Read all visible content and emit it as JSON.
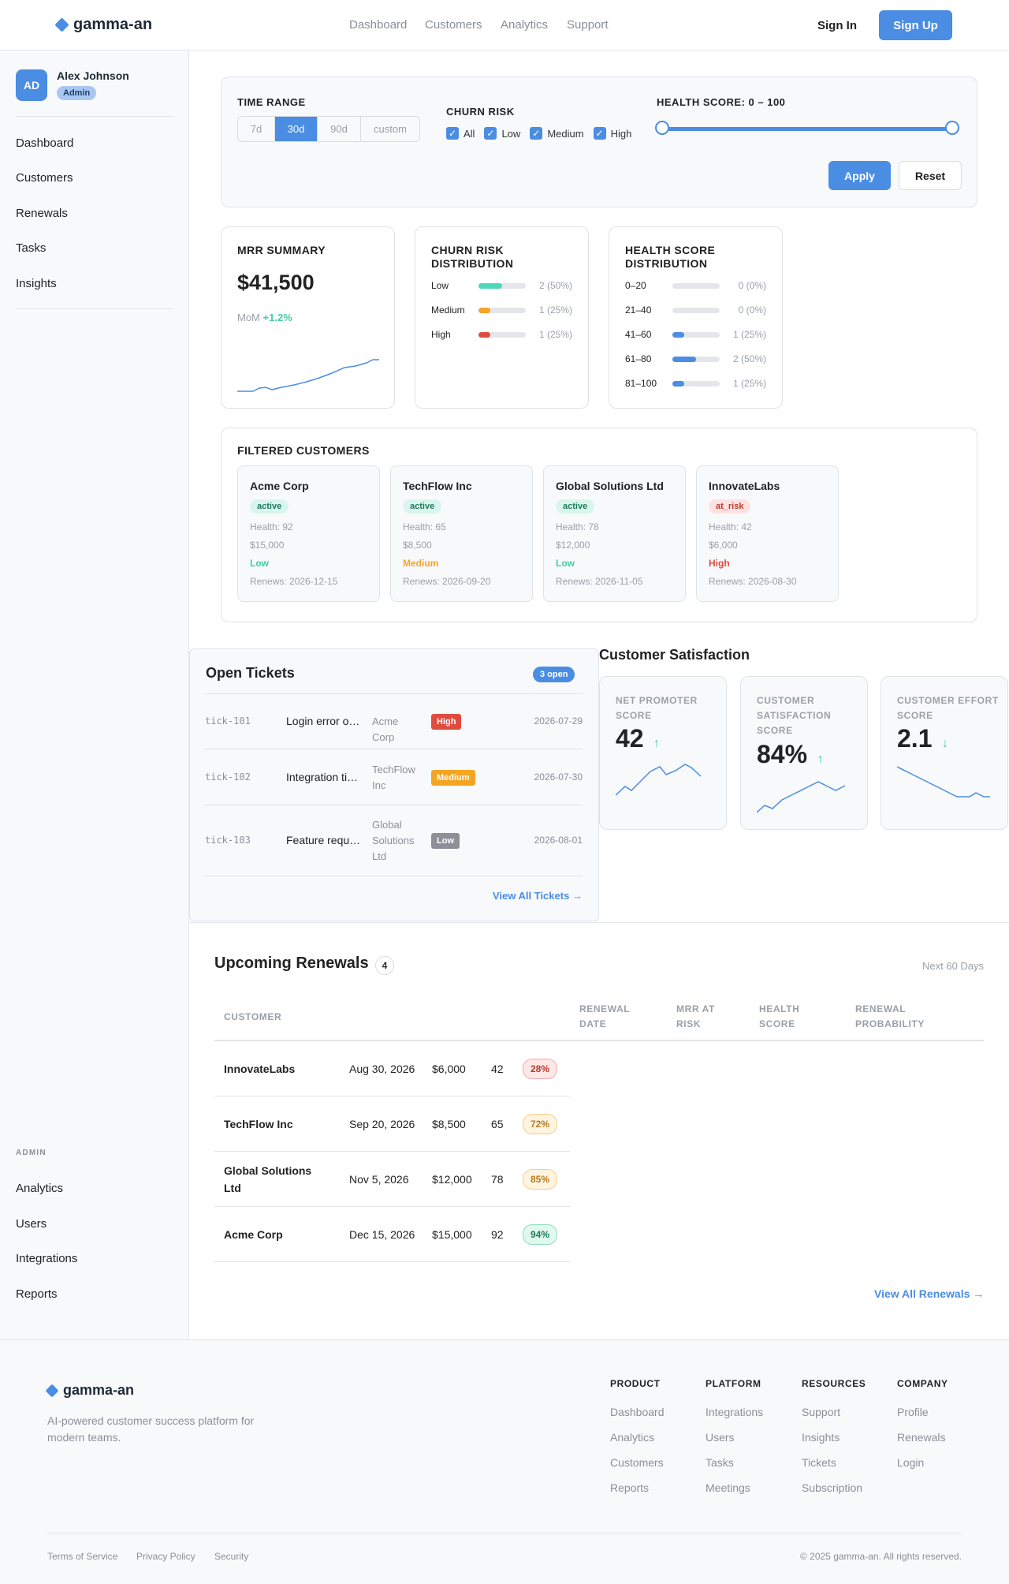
{
  "header": {
    "brand": "gamma-an",
    "nav": [
      "Dashboard",
      "Customers",
      "Analytics",
      "Support"
    ],
    "sign_in": "Sign In",
    "sign_up": "Sign Up"
  },
  "sidebar": {
    "user_initials": "AD",
    "user_name": "Alex Johnson",
    "user_role": "Admin",
    "items": [
      "Dashboard",
      "Customers",
      "Renewals",
      "Tasks",
      "Insights"
    ],
    "admin_heading": "ADMIN",
    "admin_items": [
      "Analytics",
      "Users",
      "Integrations",
      "Reports"
    ]
  },
  "filters": {
    "time_range_label": "TIME RANGE",
    "time_options": [
      "7d",
      "30d",
      "90d",
      "custom"
    ],
    "time_selected": "30d",
    "churn_label": "CHURN RISK",
    "churn_options": [
      "All",
      "Low",
      "Medium",
      "High"
    ],
    "health_label": "HEALTH SCORE: 0 – 100",
    "health_min": 0,
    "health_max": 100,
    "apply": "Apply",
    "reset": "Reset"
  },
  "mrr": {
    "title": "MRR SUMMARY",
    "value": "$41,500",
    "mom_label": "MoM",
    "mom_value": "+1.2%"
  },
  "churn_dist": {
    "title": "CHURN RISK DISTRIBUTION",
    "rows": [
      {
        "label": "Low",
        "text": "2 (50%)",
        "pct": 50,
        "color": "#4dd9b8"
      },
      {
        "label": "Medium",
        "text": "1 (25%)",
        "pct": 25,
        "color": "#f5a524"
      },
      {
        "label": "High",
        "text": "1 (25%)",
        "pct": 25,
        "color": "#e04b3f"
      }
    ]
  },
  "health_dist": {
    "title": "HEALTH SCORE DISTRIBUTION",
    "rows": [
      {
        "label": "0–20",
        "text": "0 (0%)",
        "pct": 0
      },
      {
        "label": "21–40",
        "text": "0 (0%)",
        "pct": 0
      },
      {
        "label": "41–60",
        "text": "1 (25%)",
        "pct": 25
      },
      {
        "label": "61–80",
        "text": "2 (50%)",
        "pct": 50
      },
      {
        "label": "81–100",
        "text": "1 (25%)",
        "pct": 25
      }
    ]
  },
  "filtered": {
    "title": "FILTERED CUSTOMERS",
    "customers": [
      {
        "name": "Acme Corp",
        "status": "active",
        "health": "Health: 92",
        "mrr": "$15,000",
        "risk": "Low",
        "renews": "Renews: 2026-12-15"
      },
      {
        "name": "TechFlow Inc",
        "status": "active",
        "health": "Health: 65",
        "mrr": "$8,500",
        "risk": "Medium",
        "renews": "Renews: 2026-09-20"
      },
      {
        "name": "Global Solutions Ltd",
        "status": "active",
        "health": "Health: 78",
        "mrr": "$12,000",
        "risk": "Low",
        "renews": "Renews: 2026-11-05"
      },
      {
        "name": "InnovateLabs",
        "status": "at_risk",
        "health": "Health: 42",
        "mrr": "$6,000",
        "risk": "High",
        "renews": "Renews: 2026-08-30"
      }
    ]
  },
  "tickets": {
    "title": "Open Tickets",
    "badge": "3 open",
    "rows": [
      {
        "id": "tick-101",
        "subject": "Login error o…",
        "customer": "Acme Corp",
        "priority": "High",
        "date": "2026-07-29"
      },
      {
        "id": "tick-102",
        "subject": "Integration ti…",
        "customer": "TechFlow Inc",
        "priority": "Medium",
        "date": "2026-07-30"
      },
      {
        "id": "tick-103",
        "subject": "Feature requ…",
        "customer": "Global Solutions Ltd",
        "priority": "Low",
        "date": "2026-08-01"
      }
    ],
    "view_all": "View All Tickets →"
  },
  "satisfaction": {
    "title": "Customer Satisfaction",
    "cards": [
      {
        "label": "NET PROMOTER SCORE",
        "value": "42",
        "trend": "↑"
      },
      {
        "label": "CUSTOMER SATISFACTION SCORE",
        "value": "84%",
        "trend": "↑"
      },
      {
        "label": "CUSTOMER EFFORT SCORE",
        "value": "2.1",
        "trend": "↓"
      }
    ]
  },
  "renewals": {
    "title": "Upcoming Renewals",
    "count": "4",
    "range": "Next 60 Days",
    "headers": [
      "CUSTOMER",
      "RENEWAL DATE",
      "MRR AT RISK",
      "HEALTH SCORE",
      "RENEWAL PROBABILITY"
    ],
    "rows": [
      {
        "customer": "InnovateLabs",
        "date": "Aug 30, 2026",
        "mrr": "$6,000",
        "health": "42",
        "prob": "28%"
      },
      {
        "customer": "TechFlow Inc",
        "date": "Sep 20, 2026",
        "mrr": "$8,500",
        "health": "65",
        "prob": "72%"
      },
      {
        "customer": "Global Solutions Ltd",
        "date": "Nov 5, 2026",
        "mrr": "$12,000",
        "health": "78",
        "prob": "85%"
      },
      {
        "customer": "Acme Corp",
        "date": "Dec 15, 2026",
        "mrr": "$15,000",
        "health": "92",
        "prob": "94%"
      }
    ],
    "view_all": "View All Renewals →"
  },
  "footer": {
    "brand": "gamma-an",
    "tagline": "AI-powered customer success platform for modern teams.",
    "columns": [
      {
        "heading": "PRODUCT",
        "links": [
          "Dashboard",
          "Analytics",
          "Customers",
          "Reports"
        ]
      },
      {
        "heading": "PLATFORM",
        "links": [
          "Integrations",
          "Users",
          "Tasks",
          "Meetings"
        ]
      },
      {
        "heading": "RESOURCES",
        "links": [
          "Support",
          "Insights",
          "Tickets",
          "Subscription"
        ]
      },
      {
        "heading": "COMPANY",
        "links": [
          "Profile",
          "Renewals",
          "Login"
        ]
      }
    ],
    "legal": [
      "Terms of Service",
      "Privacy Policy",
      "Security"
    ],
    "copyright": "© 2025 gamma-an. All rights reserved."
  }
}
